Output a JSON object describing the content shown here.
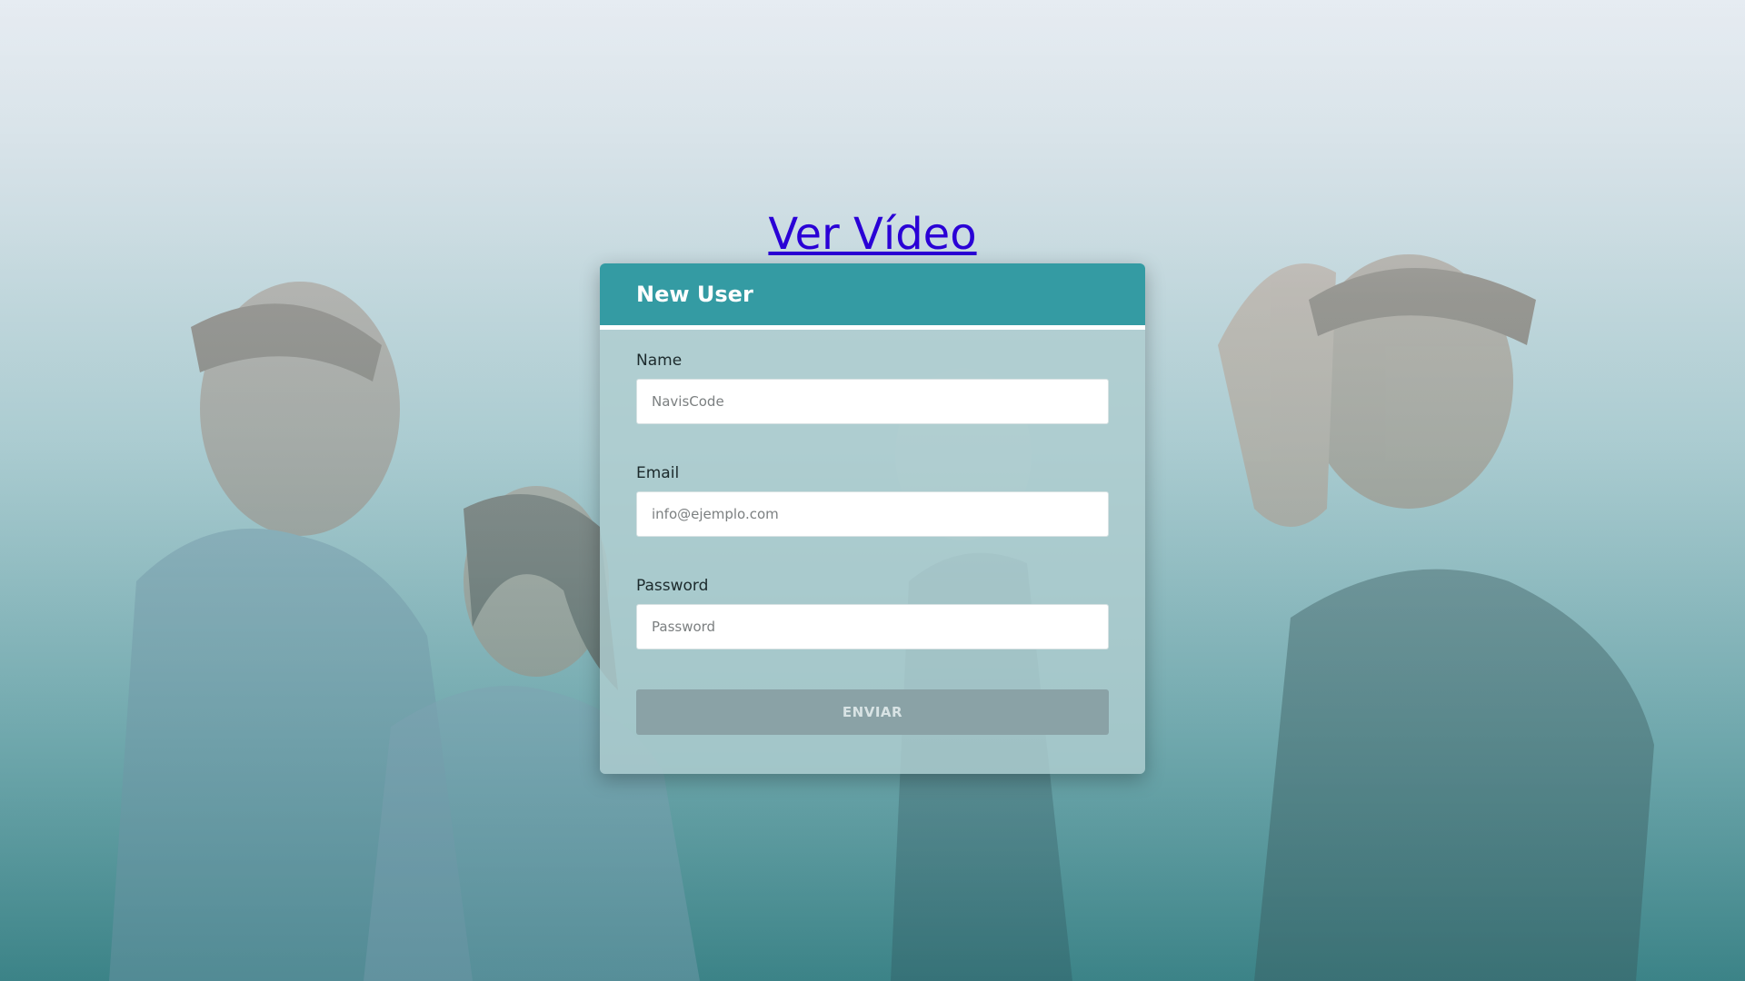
{
  "video_link": {
    "label": "Ver Vídeo"
  },
  "form": {
    "title": "New User",
    "fields": [
      {
        "label": "Name",
        "placeholder": "NavisCode",
        "value": ""
      },
      {
        "label": "Email",
        "placeholder": "info@ejemplo.com",
        "value": ""
      },
      {
        "label": "Password",
        "placeholder": "Password",
        "value": ""
      }
    ],
    "submit_label": "ENVIAR"
  },
  "colors": {
    "header": "#349ba3",
    "link": "#2a00d6",
    "button": "#8aa2a6"
  }
}
